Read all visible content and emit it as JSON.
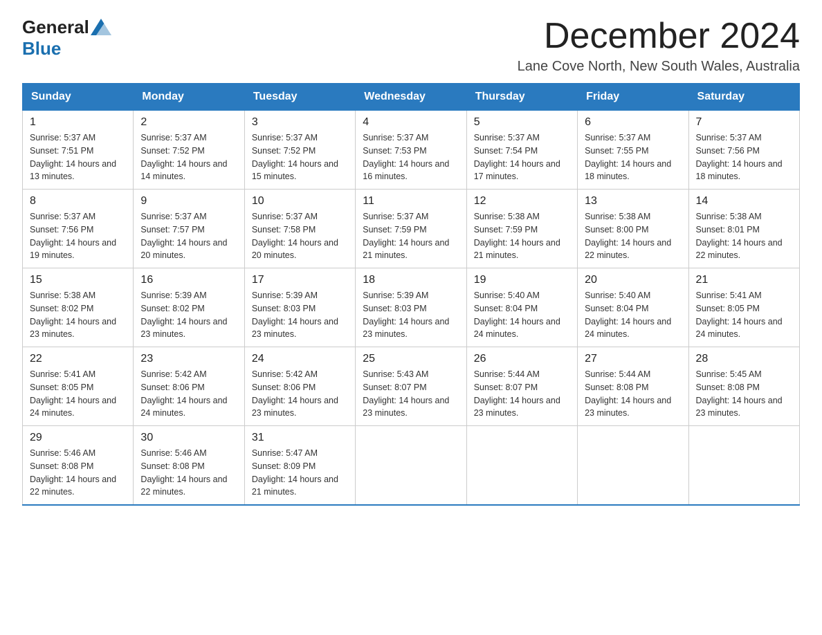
{
  "header": {
    "logo": {
      "general": "General",
      "blue": "Blue"
    },
    "title": "December 2024",
    "subtitle": "Lane Cove North, New South Wales, Australia"
  },
  "days_of_week": [
    "Sunday",
    "Monday",
    "Tuesday",
    "Wednesday",
    "Thursday",
    "Friday",
    "Saturday"
  ],
  "weeks": [
    [
      {
        "day": "1",
        "sunrise": "5:37 AM",
        "sunset": "7:51 PM",
        "daylight": "14 hours and 13 minutes."
      },
      {
        "day": "2",
        "sunrise": "5:37 AM",
        "sunset": "7:52 PM",
        "daylight": "14 hours and 14 minutes."
      },
      {
        "day": "3",
        "sunrise": "5:37 AM",
        "sunset": "7:52 PM",
        "daylight": "14 hours and 15 minutes."
      },
      {
        "day": "4",
        "sunrise": "5:37 AM",
        "sunset": "7:53 PM",
        "daylight": "14 hours and 16 minutes."
      },
      {
        "day": "5",
        "sunrise": "5:37 AM",
        "sunset": "7:54 PM",
        "daylight": "14 hours and 17 minutes."
      },
      {
        "day": "6",
        "sunrise": "5:37 AM",
        "sunset": "7:55 PM",
        "daylight": "14 hours and 18 minutes."
      },
      {
        "day": "7",
        "sunrise": "5:37 AM",
        "sunset": "7:56 PM",
        "daylight": "14 hours and 18 minutes."
      }
    ],
    [
      {
        "day": "8",
        "sunrise": "5:37 AM",
        "sunset": "7:56 PM",
        "daylight": "14 hours and 19 minutes."
      },
      {
        "day": "9",
        "sunrise": "5:37 AM",
        "sunset": "7:57 PM",
        "daylight": "14 hours and 20 minutes."
      },
      {
        "day": "10",
        "sunrise": "5:37 AM",
        "sunset": "7:58 PM",
        "daylight": "14 hours and 20 minutes."
      },
      {
        "day": "11",
        "sunrise": "5:37 AM",
        "sunset": "7:59 PM",
        "daylight": "14 hours and 21 minutes."
      },
      {
        "day": "12",
        "sunrise": "5:38 AM",
        "sunset": "7:59 PM",
        "daylight": "14 hours and 21 minutes."
      },
      {
        "day": "13",
        "sunrise": "5:38 AM",
        "sunset": "8:00 PM",
        "daylight": "14 hours and 22 minutes."
      },
      {
        "day": "14",
        "sunrise": "5:38 AM",
        "sunset": "8:01 PM",
        "daylight": "14 hours and 22 minutes."
      }
    ],
    [
      {
        "day": "15",
        "sunrise": "5:38 AM",
        "sunset": "8:02 PM",
        "daylight": "14 hours and 23 minutes."
      },
      {
        "day": "16",
        "sunrise": "5:39 AM",
        "sunset": "8:02 PM",
        "daylight": "14 hours and 23 minutes."
      },
      {
        "day": "17",
        "sunrise": "5:39 AM",
        "sunset": "8:03 PM",
        "daylight": "14 hours and 23 minutes."
      },
      {
        "day": "18",
        "sunrise": "5:39 AM",
        "sunset": "8:03 PM",
        "daylight": "14 hours and 23 minutes."
      },
      {
        "day": "19",
        "sunrise": "5:40 AM",
        "sunset": "8:04 PM",
        "daylight": "14 hours and 24 minutes."
      },
      {
        "day": "20",
        "sunrise": "5:40 AM",
        "sunset": "8:04 PM",
        "daylight": "14 hours and 24 minutes."
      },
      {
        "day": "21",
        "sunrise": "5:41 AM",
        "sunset": "8:05 PM",
        "daylight": "14 hours and 24 minutes."
      }
    ],
    [
      {
        "day": "22",
        "sunrise": "5:41 AM",
        "sunset": "8:05 PM",
        "daylight": "14 hours and 24 minutes."
      },
      {
        "day": "23",
        "sunrise": "5:42 AM",
        "sunset": "8:06 PM",
        "daylight": "14 hours and 24 minutes."
      },
      {
        "day": "24",
        "sunrise": "5:42 AM",
        "sunset": "8:06 PM",
        "daylight": "14 hours and 23 minutes."
      },
      {
        "day": "25",
        "sunrise": "5:43 AM",
        "sunset": "8:07 PM",
        "daylight": "14 hours and 23 minutes."
      },
      {
        "day": "26",
        "sunrise": "5:44 AM",
        "sunset": "8:07 PM",
        "daylight": "14 hours and 23 minutes."
      },
      {
        "day": "27",
        "sunrise": "5:44 AM",
        "sunset": "8:08 PM",
        "daylight": "14 hours and 23 minutes."
      },
      {
        "day": "28",
        "sunrise": "5:45 AM",
        "sunset": "8:08 PM",
        "daylight": "14 hours and 23 minutes."
      }
    ],
    [
      {
        "day": "29",
        "sunrise": "5:46 AM",
        "sunset": "8:08 PM",
        "daylight": "14 hours and 22 minutes."
      },
      {
        "day": "30",
        "sunrise": "5:46 AM",
        "sunset": "8:08 PM",
        "daylight": "14 hours and 22 minutes."
      },
      {
        "day": "31",
        "sunrise": "5:47 AM",
        "sunset": "8:09 PM",
        "daylight": "14 hours and 21 minutes."
      },
      null,
      null,
      null,
      null
    ]
  ]
}
